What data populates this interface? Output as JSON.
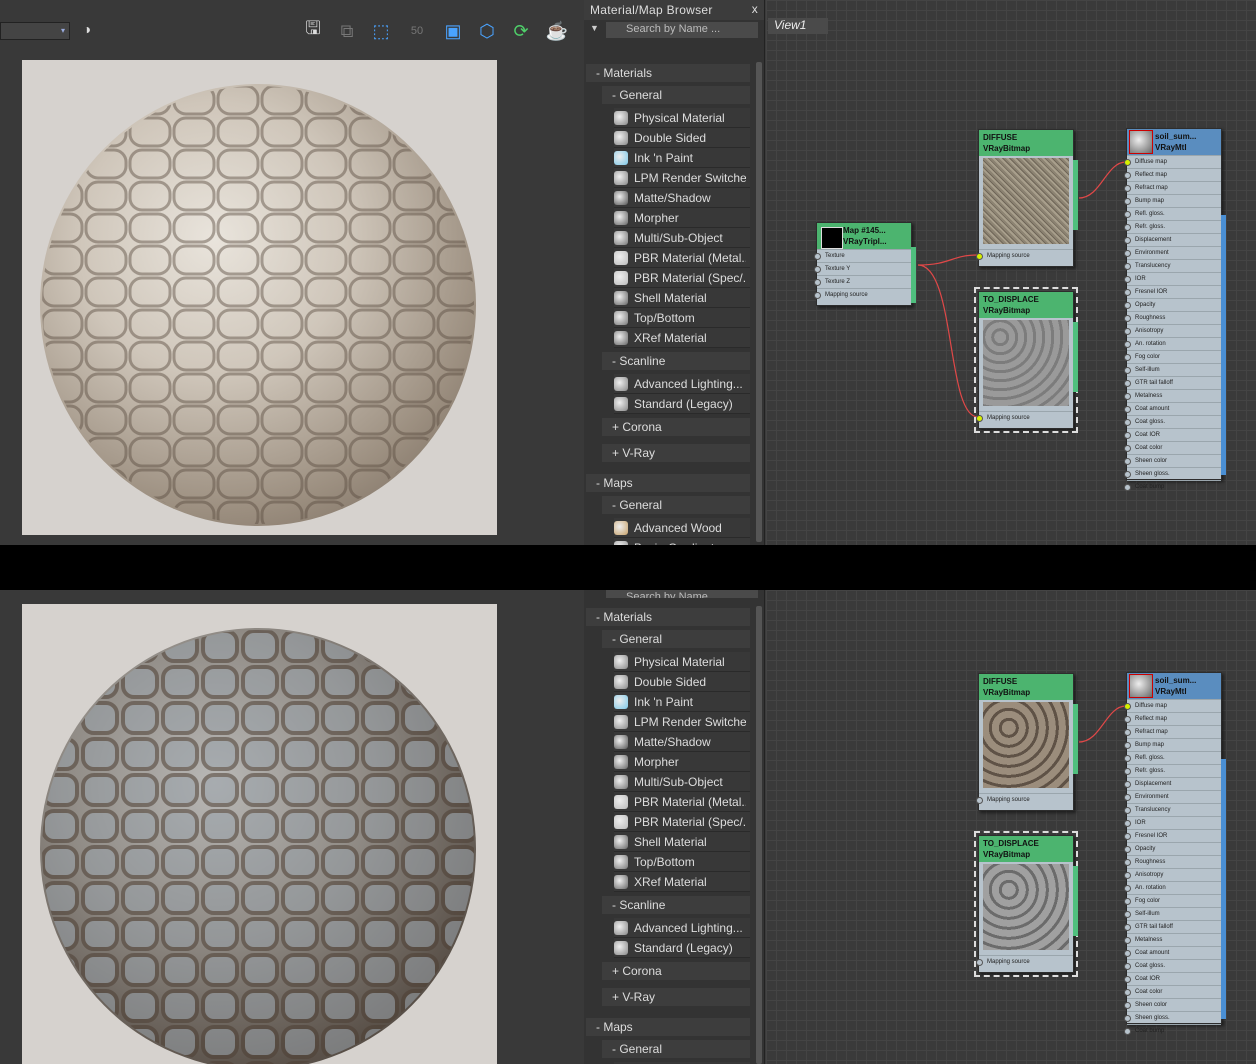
{
  "toolbar": {
    "dropdown_arrow": "▾",
    "icons": [
      "save-icon",
      "save-as-icon",
      "select-icon",
      "50-icon",
      "frame-icon",
      "region-icon",
      "refresh-icon",
      "teapot-icon"
    ]
  },
  "browser": {
    "title": "Material/Map Browser",
    "close": "x",
    "search_placeholder": "Search by Name ...",
    "materials_header": "- Materials",
    "general_header": "- General",
    "general_items": [
      "Physical Material",
      "Double Sided",
      "Ink 'n Paint",
      "LPM Render Switcher",
      "Matte/Shadow",
      "Morpher",
      "Multi/Sub-Object",
      "PBR Material (Metal...",
      "PBR Material (Spec/...",
      "Shell Material",
      "Top/Bottom",
      "XRef Material"
    ],
    "scanline_header": "- Scanline",
    "scanline_items": [
      "Advanced Lighting...",
      "Standard (Legacy)"
    ],
    "corona": "+ Corona",
    "vray": "+ V-Ray",
    "maps_header": "- Maps",
    "maps_general": "- General",
    "map_items": [
      "Advanced Wood",
      "BezierGradient"
    ]
  },
  "view": {
    "tab": "View1"
  },
  "nodes": {
    "triplanar": {
      "title1": "Map #145...",
      "title2": "VRayTripl...",
      "ports": [
        "Texture",
        "Texture Y",
        "Texture Z",
        "Mapping source"
      ]
    },
    "diffuse": {
      "title1": "DIFFUSE",
      "title2": "VRayBitmap",
      "port": "Mapping source"
    },
    "displace": {
      "title1": "TO_DISPLACE",
      "title2": "VRayBitmap",
      "port": "Mapping source"
    },
    "vraymtl": {
      "title1": "soil_sum...",
      "title2": "VRayMtl",
      "ports": [
        "Diffuse map",
        "Reflect map",
        "Refract map",
        "Bump map",
        "Refl. gloss.",
        "Refr. gloss.",
        "Displacement",
        "Environment",
        "Translucency",
        "IOR",
        "Fresnel IOR",
        "Opacity",
        "Roughness",
        "Anisotropy",
        "An. rotation",
        "Fog color",
        "Self-illum",
        "GTR tail falloff",
        "Metalness",
        "Coat amount",
        "Coat gloss.",
        "Coat IOR",
        "Coat color",
        "Sheen color",
        "Sheen gloss.",
        "Coat bump"
      ]
    }
  }
}
